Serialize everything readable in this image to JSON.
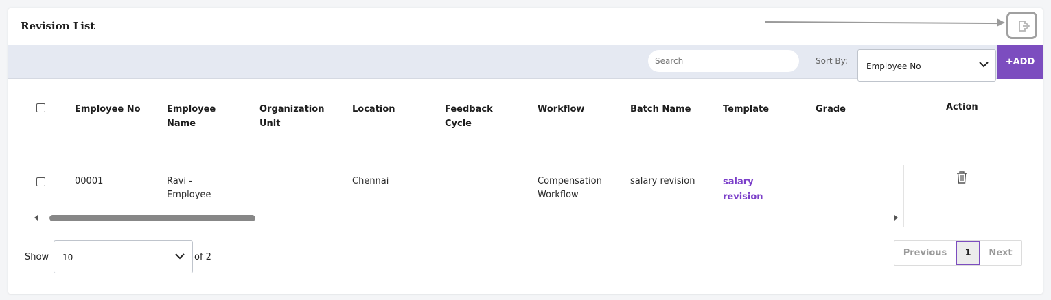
{
  "title": "Revision List",
  "toolbar": {
    "search_placeholder": "Search",
    "sort_label": "Sort By:",
    "sort_value": "Employee No",
    "add_label": "+ADD"
  },
  "table": {
    "headers": {
      "employee_no": "Employee No",
      "employee_name": [
        "Employee",
        "Name"
      ],
      "org_unit": [
        "Organization",
        "Unit"
      ],
      "location": "Location",
      "feedback_cycle": [
        "Feedback",
        "Cycle"
      ],
      "workflow": "Workflow",
      "batch_name": "Batch Name",
      "template": "Template",
      "grade": "Grade",
      "action": "Action"
    },
    "rows": [
      {
        "employee_no": "00001",
        "employee_name": [
          "Ravi -",
          "Employee"
        ],
        "org_unit": "",
        "location": "Chennai",
        "feedback_cycle": "",
        "workflow": [
          "Compensation",
          "Workflow"
        ],
        "batch_name": "salary revision",
        "template": [
          "salary",
          "revision"
        ],
        "grade": ""
      }
    ]
  },
  "footer": {
    "show_label": "Show",
    "page_size": "10",
    "of_label": "of 2",
    "prev_label": "Previous",
    "current_page": "1",
    "next_label": "Next"
  },
  "colors": {
    "accent": "#7c4dbf",
    "toolbar_bg": "#e5e9f2",
    "link": "#7b3fc9"
  },
  "icons": [
    "export-icon",
    "chevron-down-icon",
    "trash-icon",
    "checkbox-icon"
  ]
}
